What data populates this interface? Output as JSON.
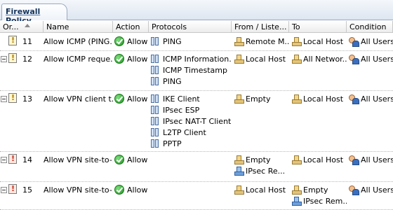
{
  "tab": {
    "title": "Firewall Policy"
  },
  "columns": [
    {
      "label": "Or..."
    },
    {
      "label": "Name"
    },
    {
      "label": "Action"
    },
    {
      "label": "Protocols"
    },
    {
      "label": "From / Liste..."
    },
    {
      "label": "To"
    },
    {
      "label": "Condition"
    }
  ],
  "rules": [
    {
      "order": "11",
      "name": "Allow ICMP (PING...",
      "action": "Allow",
      "protocols": [
        "PING"
      ],
      "from": [
        {
          "label": "Remote M...",
          "icon": "network-icon"
        }
      ],
      "to": [
        {
          "label": "Local Host",
          "icon": "network-icon"
        }
      ],
      "condition": "All Users",
      "expandable": false,
      "type": "allow"
    },
    {
      "order": "12",
      "name": "Allow ICMP reque...",
      "action": "Allow",
      "protocols": [
        "ICMP Information...",
        "ICMP Timestamp",
        "PING"
      ],
      "from": [
        {
          "label": "Local Host",
          "icon": "network-icon"
        }
      ],
      "to": [
        {
          "label": "All Networ...",
          "icon": "network-icon"
        }
      ],
      "condition": "All Users",
      "expandable": true,
      "type": "allow"
    },
    {
      "order": "13",
      "name": "Allow VPN client t...",
      "action": "Allow",
      "protocols": [
        "IKE Client",
        "IPsec ESP",
        "IPsec NAT-T Client",
        "L2TP Client",
        "PPTP"
      ],
      "from": [
        {
          "label": "Empty",
          "icon": "network-icon"
        }
      ],
      "to": [
        {
          "label": "Local Host",
          "icon": "network-icon"
        }
      ],
      "condition": "All Users",
      "expandable": true,
      "type": "allow"
    },
    {
      "order": "14",
      "name": "Allow VPN site-to-...",
      "action": "Allow",
      "protocols": [],
      "from": [
        {
          "label": "Empty",
          "icon": "network-icon"
        },
        {
          "label": "IPsec Re...",
          "icon": "ipsec-network-icon"
        }
      ],
      "to": [
        {
          "label": "Local Host",
          "icon": "network-icon"
        }
      ],
      "condition": "All Users",
      "expandable": true,
      "type": "deny"
    },
    {
      "order": "15",
      "name": "Allow VPN site-to-...",
      "action": "Allow",
      "protocols": [],
      "from": [
        {
          "label": "Local Host",
          "icon": "network-icon"
        }
      ],
      "to": [
        {
          "label": "Empty",
          "icon": "network-icon"
        },
        {
          "label": "IPsec Rem...",
          "icon": "ipsec-network-icon"
        }
      ],
      "condition": "All Users",
      "expandable": true,
      "type": "deny"
    }
  ]
}
